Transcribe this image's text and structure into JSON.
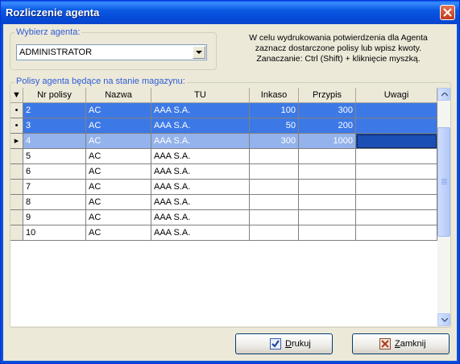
{
  "window": {
    "title": "Rozliczenie agenta"
  },
  "agent": {
    "legend": "Wybierz agenta:",
    "selected": "ADMINISTRATOR"
  },
  "info": {
    "line1": "W celu wydrukowania potwierdzenia dla Agenta",
    "line2": "zaznacz dostarczone polisy lub wpisz kwoty.",
    "line3": "Zanaczanie: Ctrl (Shift) + kliknięcie myszką."
  },
  "list": {
    "legend": "Polisy agenta będące na stanie magazynu:"
  },
  "grid": {
    "header_indicator": "▼",
    "columns": [
      "Nr polisy",
      "Nazwa",
      "TU",
      "Inkaso",
      "Przypis",
      "Uwagi"
    ],
    "rows": [
      {
        "ind": "•",
        "nr": "2",
        "nazwa": "AC",
        "tu": "AAA S.A.",
        "inkaso": "100",
        "przypis": "300",
        "uwagi": ""
      },
      {
        "ind": "•",
        "nr": "3",
        "nazwa": "AC",
        "tu": "AAA S.A.",
        "inkaso": "50",
        "przypis": "200",
        "uwagi": ""
      },
      {
        "ind": "▸",
        "nr": "4",
        "nazwa": "AC",
        "tu": "AAA S.A.",
        "inkaso": "300",
        "przypis": "1000",
        "uwagi": ""
      },
      {
        "ind": "",
        "nr": "5",
        "nazwa": "AC",
        "tu": "AAA S.A.",
        "inkaso": "",
        "przypis": "",
        "uwagi": ""
      },
      {
        "ind": "",
        "nr": "6",
        "nazwa": "AC",
        "tu": "AAA S.A.",
        "inkaso": "",
        "przypis": "",
        "uwagi": ""
      },
      {
        "ind": "",
        "nr": "7",
        "nazwa": "AC",
        "tu": "AAA S.A.",
        "inkaso": "",
        "przypis": "",
        "uwagi": ""
      },
      {
        "ind": "",
        "nr": "8",
        "nazwa": "AC",
        "tu": "AAA S.A.",
        "inkaso": "",
        "przypis": "",
        "uwagi": ""
      },
      {
        "ind": "",
        "nr": "9",
        "nazwa": "AC",
        "tu": "AAA S.A.",
        "inkaso": "",
        "przypis": "",
        "uwagi": ""
      },
      {
        "ind": "",
        "nr": "10",
        "nazwa": "AC",
        "tu": "AAA S.A.",
        "inkaso": "",
        "przypis": "",
        "uwagi": ""
      }
    ]
  },
  "buttons": {
    "print": {
      "label_first": "D",
      "label_rest": "rukuj"
    },
    "close": {
      "label_first": "Z",
      "label_rest": "amknij"
    }
  },
  "colors": {
    "titlebar": "#0a5ae3",
    "selection": "#3d79e6",
    "current_row": "#94b2eb",
    "legend_text": "#2d5bd8"
  }
}
